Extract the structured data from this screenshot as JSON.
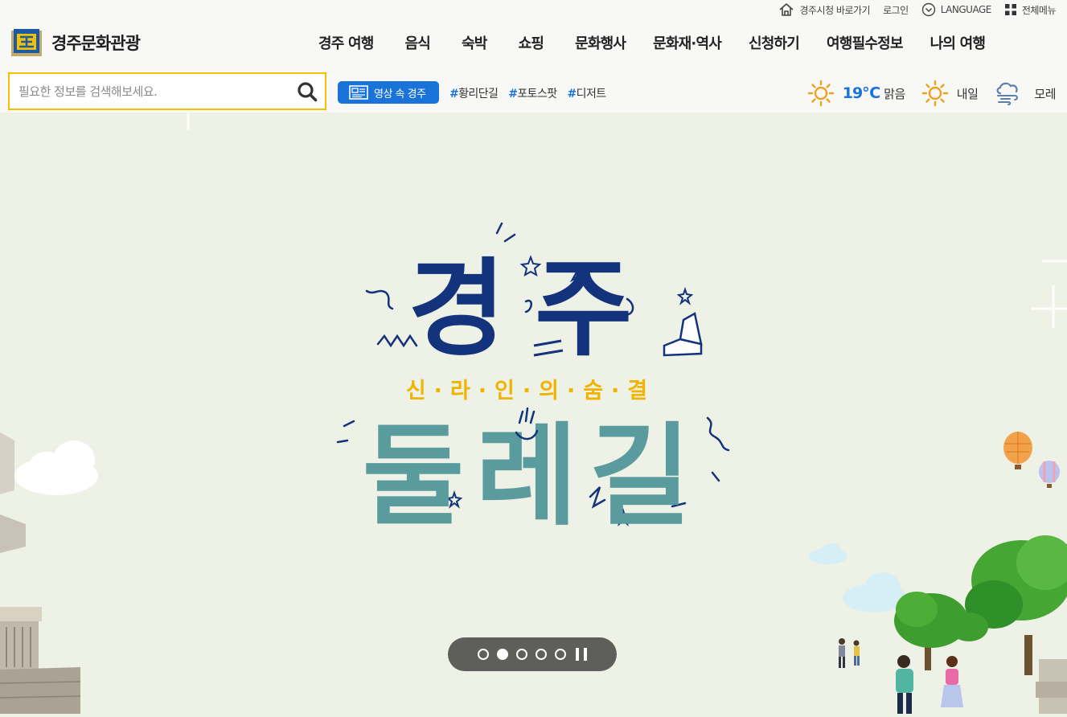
{
  "utility": {
    "city_hall": "경주시청 바로가기",
    "login": "로그인",
    "language": "LANGUAGE",
    "all_menu": "전체메뉴"
  },
  "logo": {
    "text": "경주문화관광"
  },
  "gnb": [
    "경주 여행",
    "음식",
    "숙박",
    "쇼핑",
    "문화행사",
    "문화재·역사",
    "신청하기",
    "여행필수정보",
    "나의 여행"
  ],
  "search": {
    "placeholder": "필요한 정보를 검색해보세요."
  },
  "video_button": "영상 속 경주",
  "tags": [
    {
      "hash": "#",
      "text": "황리단길"
    },
    {
      "hash": "#",
      "text": "포토스팟"
    },
    {
      "hash": "#",
      "text": "디저트"
    }
  ],
  "weather": {
    "today_temp": "19℃",
    "today_cond": "맑음",
    "tomorrow": "내일",
    "day_after": "모레"
  },
  "hero": {
    "title_top": "경주",
    "subtitle": "신·라·인·의·숨·결",
    "title_bottom": "둘레길"
  },
  "slider": {
    "total": 5,
    "active_index": 1
  },
  "colors": {
    "accent_blue": "#1a73d9",
    "search_border": "#f2c200",
    "title_navy": "#13347c",
    "title_teal": "#5a9b9d",
    "subtitle_yellow": "#f0b400"
  }
}
